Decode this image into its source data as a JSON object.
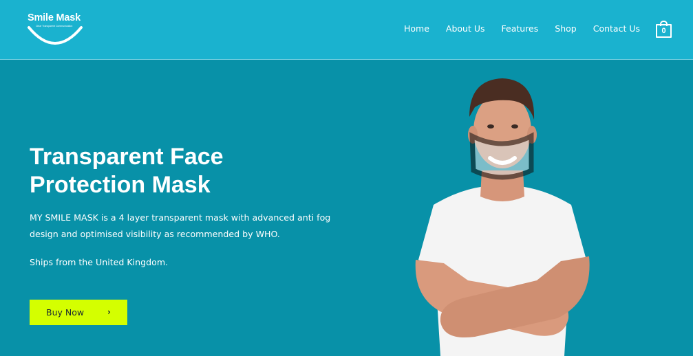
{
  "header": {
    "logo_text": "Smile Mask",
    "logo_tagline": "Clear Transparent Communication",
    "nav": [
      "Home",
      "About Us",
      "Features",
      "Shop",
      "Contact Us"
    ],
    "cart_count": "0"
  },
  "hero": {
    "title_line1": "Transparent Face",
    "title_line2": "Protection Mask",
    "description": "MY SMILE MASK is a 4 layer transparent mask with advanced anti fog design and optimised visibility as recommended by WHO.",
    "ships": "Ships from the United Kingdom.",
    "button_label": "Buy Now",
    "button_icon": "chevron-right-icon"
  },
  "colors": {
    "header_bg": "#1ab2cf",
    "hero_bg": "#0891a8",
    "button_bg": "#d4ff00"
  }
}
